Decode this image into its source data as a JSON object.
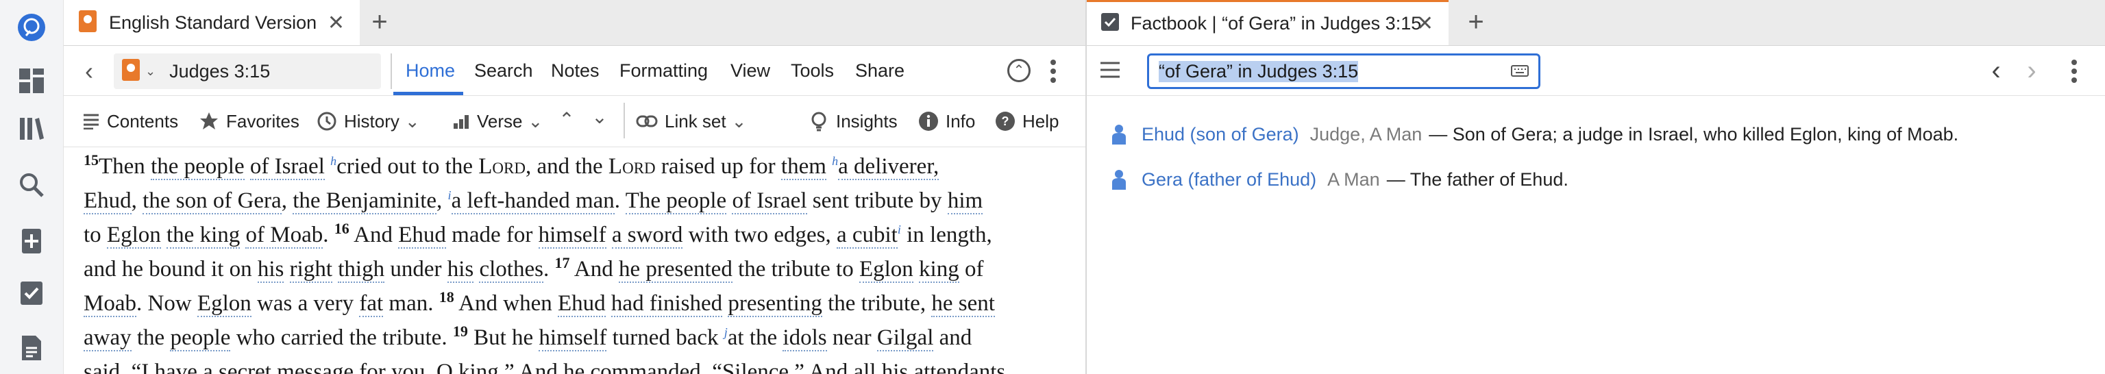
{
  "left_panel": {
    "tab_title": "English Standard Version",
    "reference": "Judges 3:15",
    "menu": [
      "Home",
      "Search",
      "Notes",
      "Formatting",
      "View",
      "Tools",
      "Share"
    ],
    "subtoolbar": {
      "contents": "Contents",
      "favorites": "Favorites",
      "history": "History",
      "verse": "Verse",
      "link_set": "Link set",
      "insights": "Insights",
      "info": "Info",
      "help": "Help"
    },
    "text_lines": [
      [
        {
          "t": "15",
          "c": "vn"
        },
        {
          "t": "Then "
        },
        {
          "t": "the people",
          "c": "u"
        },
        {
          "t": " "
        },
        {
          "t": "of Israel",
          "c": "u"
        },
        {
          "t": " "
        },
        {
          "t": "h",
          "c": "fn"
        },
        {
          "t": "cried out to the "
        },
        {
          "t": "Lord",
          "c": "sc"
        },
        {
          "t": ", and the "
        },
        {
          "t": "Lord",
          "c": "sc"
        },
        {
          "t": " raised up for "
        },
        {
          "t": "them",
          "c": "u"
        },
        {
          "t": " "
        },
        {
          "t": "h",
          "c": "fn"
        },
        {
          "t": "a deliverer,",
          "c": "u"
        }
      ],
      [
        {
          "t": "Ehud",
          "c": "u"
        },
        {
          "t": ", "
        },
        {
          "t": "the son of Gera",
          "c": "u"
        },
        {
          "t": ", "
        },
        {
          "t": "the Benjaminite",
          "c": "u"
        },
        {
          "t": ", "
        },
        {
          "t": "i",
          "c": "fn"
        },
        {
          "t": "a left-handed man",
          "c": "u"
        },
        {
          "t": ". "
        },
        {
          "t": "The people",
          "c": "u"
        },
        {
          "t": " "
        },
        {
          "t": "of Israel",
          "c": "u"
        },
        {
          "t": " sent tribute by "
        },
        {
          "t": "him",
          "c": "u"
        }
      ],
      [
        {
          "t": "to "
        },
        {
          "t": "Eglon",
          "c": "u"
        },
        {
          "t": " "
        },
        {
          "t": "the king",
          "c": "u"
        },
        {
          "t": " "
        },
        {
          "t": "of Moab",
          "c": "u"
        },
        {
          "t": ". "
        },
        {
          "t": "16",
          "c": "vn"
        },
        {
          "t": " And "
        },
        {
          "t": "Ehud",
          "c": "u"
        },
        {
          "t": " made for "
        },
        {
          "t": "himself",
          "c": "u"
        },
        {
          "t": " "
        },
        {
          "t": "a sword",
          "c": "u"
        },
        {
          "t": " with two edges, "
        },
        {
          "t": "a cubit",
          "c": "u"
        },
        {
          "t": "i",
          "c": "fn"
        },
        {
          "t": " in length,"
        }
      ],
      [
        {
          "t": "and he bound it on "
        },
        {
          "t": "his",
          "c": "u"
        },
        {
          "t": " "
        },
        {
          "t": "right",
          "c": "u"
        },
        {
          "t": " "
        },
        {
          "t": "thigh",
          "c": "u"
        },
        {
          "t": " under "
        },
        {
          "t": "his",
          "c": "u"
        },
        {
          "t": " "
        },
        {
          "t": "clothes",
          "c": "u"
        },
        {
          "t": ". "
        },
        {
          "t": "17",
          "c": "vn"
        },
        {
          "t": " And "
        },
        {
          "t": "he presented",
          "c": "u"
        },
        {
          "t": " the tribute to "
        },
        {
          "t": "Eglon",
          "c": "u"
        },
        {
          "t": " "
        },
        {
          "t": "king",
          "c": "u"
        },
        {
          "t": " of"
        }
      ],
      [
        {
          "t": "Moab",
          "c": "u"
        },
        {
          "t": ". Now "
        },
        {
          "t": "Eglon",
          "c": "u"
        },
        {
          "t": " was a very "
        },
        {
          "t": "fat",
          "c": "u"
        },
        {
          "t": " man. "
        },
        {
          "t": "18",
          "c": "vn"
        },
        {
          "t": " And when "
        },
        {
          "t": "Ehud",
          "c": "u"
        },
        {
          "t": " "
        },
        {
          "t": "had finished",
          "c": "u"
        },
        {
          "t": " "
        },
        {
          "t": "presenting",
          "c": "u"
        },
        {
          "t": " the tribute, "
        },
        {
          "t": "he sent",
          "c": "u"
        }
      ],
      [
        {
          "t": "away",
          "c": "u"
        },
        {
          "t": " the "
        },
        {
          "t": "people",
          "c": "u"
        },
        {
          "t": " who carried the tribute. "
        },
        {
          "t": "19",
          "c": "vn"
        },
        {
          "t": " But he "
        },
        {
          "t": "himself",
          "c": "u"
        },
        {
          "t": " turned back "
        },
        {
          "t": "j",
          "c": "fn"
        },
        {
          "t": "at the "
        },
        {
          "t": "idols",
          "c": "u"
        },
        {
          "t": " near "
        },
        {
          "t": "Gilgal",
          "c": "u"
        },
        {
          "t": " and"
        }
      ],
      [
        {
          "t": "said, “I have a secret message for you, O king.” And he commanded, “Silence.” And all his attendants"
        }
      ]
    ]
  },
  "right_panel": {
    "tab_title": "Factbook | “of Gera” in Judges 3:15",
    "search_value": "“of Gera” in Judges 3:15",
    "facts": [
      {
        "name": "Ehud (son of Gera)",
        "type": "Judge, A Man",
        "desc": "— Son of Gera; a judge in Israel, who killed Eglon, king of Moab."
      },
      {
        "name": "Gera (father of Ehud)",
        "type": "A Man",
        "desc": "— The father of Ehud."
      }
    ]
  },
  "colors": {
    "accent": "#3b72c6",
    "brand_orange": "#e8792b",
    "rail_blue": "#2f6fd6"
  },
  "icons": [
    "logos-icon",
    "dashboard-icon",
    "library-icon",
    "search-icon",
    "add-note-icon",
    "checklist-icon",
    "document-icon"
  ]
}
